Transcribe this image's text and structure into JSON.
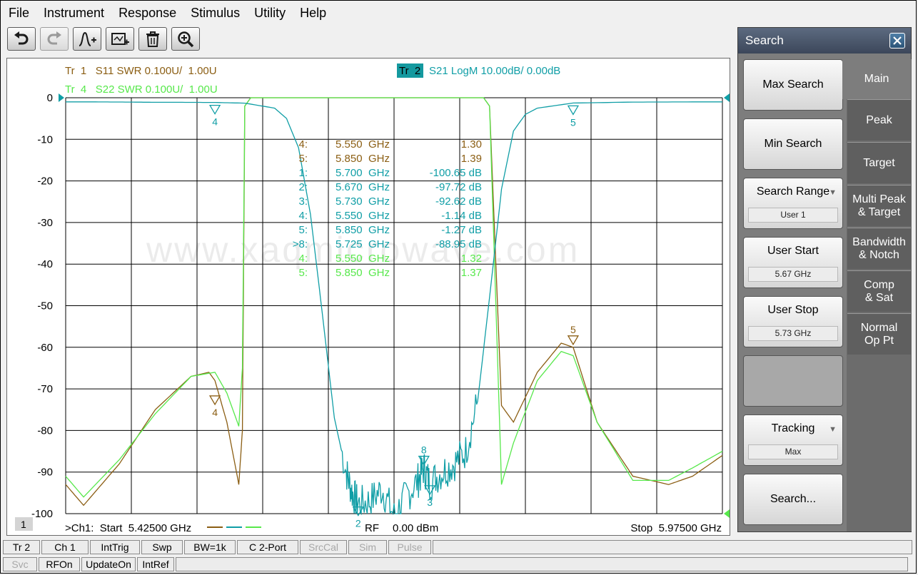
{
  "menu": [
    "File",
    "Instrument",
    "Response",
    "Stimulus",
    "Utility",
    "Help"
  ],
  "toolbar": [
    {
      "name": "undo-button",
      "icon": "undo-icon",
      "dim": false
    },
    {
      "name": "redo-button",
      "icon": "redo-icon",
      "dim": true
    },
    {
      "name": "add-marker-button",
      "icon": "marker-add-icon",
      "dim": false
    },
    {
      "name": "add-trace-button",
      "icon": "trace-add-icon",
      "dim": false
    },
    {
      "name": "delete-button",
      "icon": "trash-icon",
      "dim": false
    },
    {
      "name": "zoom-button",
      "icon": "zoom-in-icon",
      "dim": false
    }
  ],
  "plot": {
    "trace_labels": {
      "tr1": "Tr  1   S11 SWR 0.100U/  1.00U",
      "tr4": "Tr  4   S22 SWR 0.100U/  1.00U",
      "tr2_badge": "Tr  2",
      "tr2": "S21 LogM 10.00dB/  0.00dB"
    },
    "colors": {
      "tr1": "#8b5e13",
      "tr2": "#109ea6",
      "tr4": "#57e84b",
      "badge_bg": "#14999f",
      "grid": "#000000"
    },
    "watermark": "www.xaqmicrowave.com",
    "channel_badge": "1",
    "start_label": ">Ch1:  Start  5.42500 GHz",
    "stop_label": "Stop  5.97500 GHz",
    "rf_label": "RF",
    "power_label": "0.00 dBm",
    "marker_table": [
      {
        "id": "4:",
        "freq": "5.550",
        "unit": "GHz",
        "value": "1.30",
        "trace": "tr1"
      },
      {
        "id": "5:",
        "freq": "5.850",
        "unit": "GHz",
        "value": "1.39",
        "trace": "tr1"
      },
      {
        "id": "1:",
        "freq": "5.700",
        "unit": "GHz",
        "value": "-100.65 dB",
        "trace": "tr2"
      },
      {
        "id": "2:",
        "freq": "5.670",
        "unit": "GHz",
        "value": "-97.72 dB",
        "trace": "tr2"
      },
      {
        "id": "3:",
        "freq": "5.730",
        "unit": "GHz",
        "value": "-92.62 dB",
        "trace": "tr2"
      },
      {
        "id": "4:",
        "freq": "5.550",
        "unit": "GHz",
        "value": "-1.14 dB",
        "trace": "tr2"
      },
      {
        "id": "5:",
        "freq": "5.850",
        "unit": "GHz",
        "value": "-1.27 dB",
        "trace": "tr2"
      },
      {
        "id": ">8:",
        "freq": "5.725",
        "unit": "GHz",
        "value": "-88.95 dB",
        "trace": "tr2"
      },
      {
        "id": "4:",
        "freq": "5.550",
        "unit": "GHz",
        "value": "1.32",
        "trace": "tr4"
      },
      {
        "id": "5:",
        "freq": "5.850",
        "unit": "GHz",
        "value": "1.37",
        "trace": "tr4"
      }
    ]
  },
  "chart_data": {
    "type": "line",
    "xlim": [
      5.425,
      5.975
    ],
    "ylim": [
      -100,
      0
    ],
    "yticks": [
      "0",
      "-10",
      "-20",
      "-30",
      "-40",
      "-50",
      "-60",
      "-70",
      "-80",
      "-90",
      "-100"
    ],
    "grid": true,
    "series": [
      {
        "name": "S21 LogM",
        "trace": "tr2",
        "x": [
          5.425,
          5.45,
          5.48,
          5.5,
          5.52,
          5.55,
          5.575,
          5.6,
          5.61,
          5.62,
          5.63,
          5.64,
          5.65,
          5.66,
          5.665,
          5.67,
          5.68,
          5.69,
          5.7,
          5.71,
          5.72,
          5.725,
          5.73,
          5.74,
          5.75,
          5.76,
          5.77,
          5.78,
          5.79,
          5.8,
          5.81,
          5.82,
          5.85,
          5.9,
          5.95,
          5.975
        ],
        "y": [
          -1.0,
          -1.0,
          -1.05,
          -1.1,
          -1.1,
          -1.14,
          -1.3,
          -2.5,
          -5,
          -12,
          -28,
          -52,
          -77,
          -90,
          -95,
          -97.7,
          -97,
          -94,
          -100.6,
          -96,
          -92,
          -89,
          -92.6,
          -90,
          -88,
          -85,
          -73,
          -48,
          -22,
          -8,
          -4,
          -2.5,
          -1.27,
          -1.05,
          -1.0,
          -1.0
        ]
      },
      {
        "name": "S11 SWR",
        "trace": "tr1",
        "x": [
          5.425,
          5.44,
          5.47,
          5.5,
          5.53,
          5.545,
          5.55,
          5.56,
          5.57,
          5.573,
          5.575,
          5.58,
          5.6,
          5.775,
          5.78,
          5.79,
          5.8,
          5.82,
          5.84,
          5.85,
          5.87,
          5.9,
          5.93,
          5.95,
          5.975
        ],
        "y": [
          -93,
          -98,
          -88,
          -75,
          -67,
          -66,
          -68,
          -78,
          -93,
          -80,
          -2,
          0,
          0,
          0,
          -2,
          -74,
          -78,
          -66,
          -59,
          -60,
          -78,
          -91,
          -93,
          -91,
          -86
        ]
      },
      {
        "name": "S22 SWR",
        "trace": "tr4",
        "x": [
          5.425,
          5.44,
          5.47,
          5.5,
          5.53,
          5.55,
          5.56,
          5.57,
          5.573,
          5.575,
          5.58,
          5.6,
          5.775,
          5.78,
          5.79,
          5.8,
          5.82,
          5.84,
          5.85,
          5.87,
          5.9,
          5.93,
          5.95,
          5.975
        ],
        "y": [
          -91,
          -96,
          -87,
          -76,
          -67,
          -66,
          -71,
          -79,
          -65,
          -2,
          0,
          0,
          0,
          -2,
          -93,
          -83,
          -68,
          -61,
          -62,
          -78,
          -92,
          -92,
          -89,
          -85
        ]
      }
    ],
    "markers": [
      {
        "label": "4",
        "x": 5.55,
        "y": -1.14,
        "trace": "tr2",
        "pos": "below"
      },
      {
        "label": "5",
        "x": 5.85,
        "y": -1.27,
        "trace": "tr2",
        "pos": "below"
      },
      {
        "label": "4",
        "x": 5.55,
        "y": -71,
        "trace": "tr1",
        "pos": "below"
      },
      {
        "label": "5",
        "x": 5.85,
        "y": -60,
        "trace": "tr1",
        "pos": "above"
      },
      {
        "label": "2",
        "x": 5.67,
        "y": -97.7,
        "trace": "tr2",
        "pos": "below"
      },
      {
        "label": "3",
        "x": 5.73,
        "y": -92.6,
        "trace": "tr2",
        "pos": "below"
      },
      {
        "label": "8",
        "x": 5.725,
        "y": -88.95,
        "trace": "tr2",
        "pos": "above"
      }
    ]
  },
  "search_panel": {
    "title": "Search",
    "buttons": {
      "max_search": "Max Search",
      "min_search": "Min Search",
      "search_range": "Search Range",
      "search_range_value": "User 1",
      "user_start": "User Start",
      "user_start_value": "5.67 GHz",
      "user_stop": "User Stop",
      "user_stop_value": "5.73 GHz",
      "tracking": "Tracking",
      "tracking_value": "Max",
      "search_more": "Search..."
    },
    "tabs": [
      "Main",
      "Peak",
      "Target",
      "Multi Peak\n& Target",
      "Bandwidth\n& Notch",
      "Comp\n& Sat",
      "Normal\nOp Pt"
    ]
  },
  "status_row1": [
    {
      "label": "Tr 2",
      "w": 52,
      "dim": false
    },
    {
      "label": "Ch 1",
      "w": 66,
      "dim": false
    },
    {
      "label": "IntTrig",
      "w": 70,
      "dim": false
    },
    {
      "label": "Swp",
      "w": 58,
      "dim": false
    },
    {
      "label": "BW=1k",
      "w": 72,
      "dim": false
    },
    {
      "label": "C  2-Port",
      "w": 86,
      "dim": false
    },
    {
      "label": "SrcCal",
      "w": 66,
      "dim": true
    },
    {
      "label": "Sim",
      "w": 54,
      "dim": true
    },
    {
      "label": "Pulse",
      "w": 60,
      "dim": true
    },
    {
      "label": "",
      "w": 672,
      "dim": false
    }
  ],
  "status_row2": [
    {
      "label": "Svc",
      "w": 48,
      "dim": true
    },
    {
      "label": "RFOn",
      "w": 58,
      "dim": false
    },
    {
      "label": "UpdateOn",
      "w": 76,
      "dim": false
    },
    {
      "label": "IntRef",
      "w": 52,
      "dim": false
    },
    {
      "label": "",
      "w": 1026,
      "dim": false
    }
  ]
}
